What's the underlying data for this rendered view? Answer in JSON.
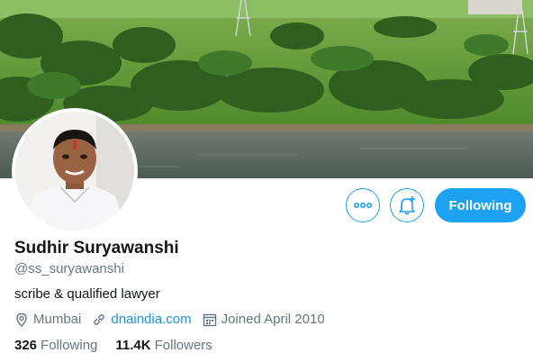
{
  "profile": {
    "name": "Sudhir Suryawanshi",
    "handle": "@ss_suryawanshi",
    "bio": "scribe & qualified lawyer",
    "location": "Mumbai",
    "website": "dnaindia.com",
    "joined": "Joined April 2010"
  },
  "actions": {
    "more_icon": "more-icon",
    "notify_icon": "bell-plus-icon",
    "following_label": "Following"
  },
  "stats": {
    "following_count": "326",
    "following_label": "Following",
    "followers_count": "11.4K",
    "followers_label": "Followers"
  },
  "colors": {
    "accent": "#1da1f2",
    "link": "#1b95e0",
    "secondary_text": "#657786"
  }
}
